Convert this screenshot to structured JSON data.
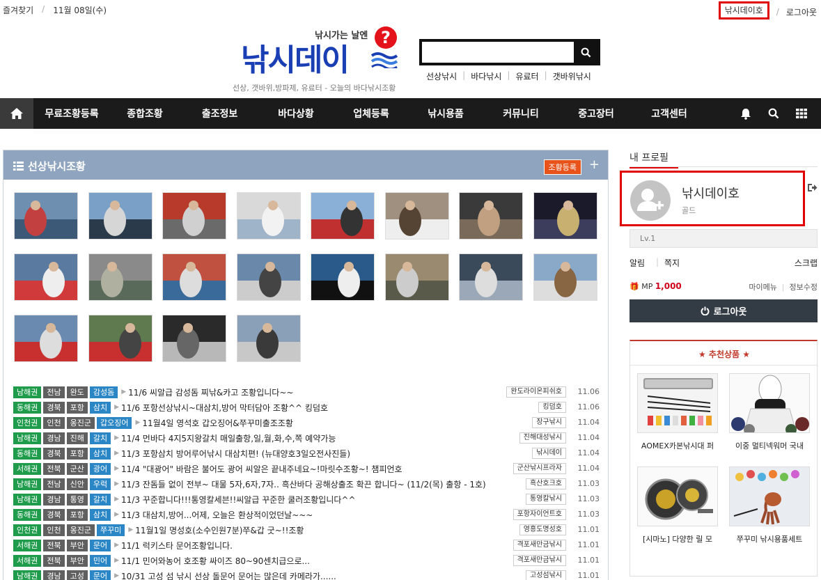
{
  "topbar": {
    "bookmark": "즐겨찾기",
    "date": "11월 08일(수)",
    "user": "낚시데이호",
    "logout": "로그아웃"
  },
  "logo": {
    "tagline_top": "낚시가는 날엔",
    "brand": "낚시데이",
    "qmark": "?",
    "tagline_bottom": "선상, 갯바위,방파제, 유료터 - 오늘의 바다낚시조황"
  },
  "search": {
    "placeholder": "",
    "links": [
      "선상낚시",
      "바다낚시",
      "유료터",
      "갯바위낚시"
    ]
  },
  "nav": {
    "items": [
      "무료조황등록",
      "종합조황",
      "출조정보",
      "바다상황",
      "업체등록",
      "낚시용품",
      "커뮤니티",
      "중고장터",
      "고객센터"
    ]
  },
  "panel": {
    "title": "선상낚시조황",
    "register": "조황등록",
    "plus": "+"
  },
  "posts": [
    {
      "t1": "남해권",
      "t2": "전남",
      "t3": "완도",
      "t4": "감성돔",
      "subject": "11/6 씨알급 감성돔 찌낚&카고 조황입니다~~",
      "author": "완도라이온피쉬호",
      "date": "11.06"
    },
    {
      "t1": "동해권",
      "t2": "경북",
      "t3": "포항",
      "t4": "삼치",
      "subject": "11/6 포항선상낚시~대삼치,방어 막터담아 조황^^ 킹덤호",
      "author": "킹덤호",
      "date": "11.06"
    },
    {
      "t1": "인천권",
      "t2": "인천",
      "t3": "옹진군",
      "t4": "갑오징어",
      "subject": "11월4일 영석호 갑오징어&쭈꾸미출조조황",
      "author": "장구낚시",
      "date": "11.04"
    },
    {
      "t1": "남해권",
      "t2": "경남",
      "t3": "진해",
      "t4": "갈치",
      "subject": "11/4 먼바다 4지5지왕갈치 매일출항,일,월,화,수,쪽 예약가능",
      "author": "진해대성낚시",
      "date": "11.04"
    },
    {
      "t1": "동해권",
      "t2": "경북",
      "t3": "포항",
      "t4": "삼치",
      "subject": "11/3 포항삼치 방어루어낚시 대삼치편! (뉴대양호3일오전사진들)",
      "author": "낚시데이",
      "date": "11.04"
    },
    {
      "t1": "서해권",
      "t2": "전북",
      "t3": "군산",
      "t4": "광어",
      "subject": "11/4 \"대광어\" 바람은 불어도 광어 씨알은 끝내주네요~!마릿수조황~! 챔피언호",
      "author": "군산낚시프라자",
      "date": "11.04"
    },
    {
      "t1": "남해권",
      "t2": "전남",
      "t3": "신안",
      "t4": "우럭",
      "subject": "11/3 잔돔들 없이 전부~ 대물 5자,6자,7자.. 흑산바다 공해상출조 확끈 합니다~ (11/2(목) 출항 - 1호)",
      "author": "흑산호크호",
      "date": "11.03"
    },
    {
      "t1": "남해권",
      "t2": "경남",
      "t3": "통영",
      "t4": "갈치",
      "subject": "11/3 꾸준합니다!!!통영칼세븐!!씨알급 꾸준한 쿨러조황입니다^^",
      "author": "통영칼낚시",
      "date": "11.03"
    },
    {
      "t1": "동해권",
      "t2": "경북",
      "t3": "포항",
      "t4": "삼치",
      "subject": "11/3 대삼치,방어...어제, 오늘은 환상적이었던날~~~",
      "author": "포항자이언트호",
      "date": "11.03"
    },
    {
      "t1": "인천권",
      "t2": "인천",
      "t3": "옹진군",
      "t4": "쭈꾸미",
      "subject": "11월1일 명성호(소수인원7분)쭈&갑 굿~!!조황",
      "author": "영흥도명성호",
      "date": "11.01"
    },
    {
      "t1": "서해권",
      "t2": "전북",
      "t3": "부안",
      "t4": "문어",
      "subject": "11/1 럭키스타 문어조황입니다.",
      "author": "격포새만금낚시",
      "date": "11.01"
    },
    {
      "t1": "서해권",
      "t2": "전북",
      "t3": "부안",
      "t4": "민어",
      "subject": "11/1 민어와농어 호조황 싸이즈 80~90센치급으로...",
      "author": "격포새만금낚시",
      "date": "11.01"
    },
    {
      "t1": "남해권",
      "t2": "경남",
      "t3": "고성",
      "t4": "문어",
      "subject": "10/31 고성 섬 낚시 선상 돌문어 문어는 많은데 카메라가......",
      "author": "고성섬낚시",
      "date": "11.01"
    }
  ],
  "profile": {
    "tab": "내 프로필",
    "name": "낚시데이호",
    "grade": "골드",
    "level": "Lv.1",
    "alarm": "알림",
    "memo": "쪽지",
    "scrap": "스크랩",
    "mp_label": "MP",
    "mp_value": "1,000",
    "my_menu": "마이메뉴",
    "edit": "정보수정",
    "logout": "로그아웃"
  },
  "recommend": {
    "title": "★ 추천상품 ★",
    "products": [
      "AOMEX카본낚시대 퍼",
      "이중 멀티넥워머 국내",
      "[시마노] 다양한 릴 모",
      "쭈꾸미 낚시용품세트"
    ]
  },
  "colors": {
    "nav_bg": "#1b1b1b",
    "panel_head": "#8ea4bf",
    "tag_region": "#1f9c4b",
    "tag_gray": "#606060",
    "tag_fish": "#2b86c6",
    "highlight": "#e00000",
    "mp": "#d0021b"
  }
}
